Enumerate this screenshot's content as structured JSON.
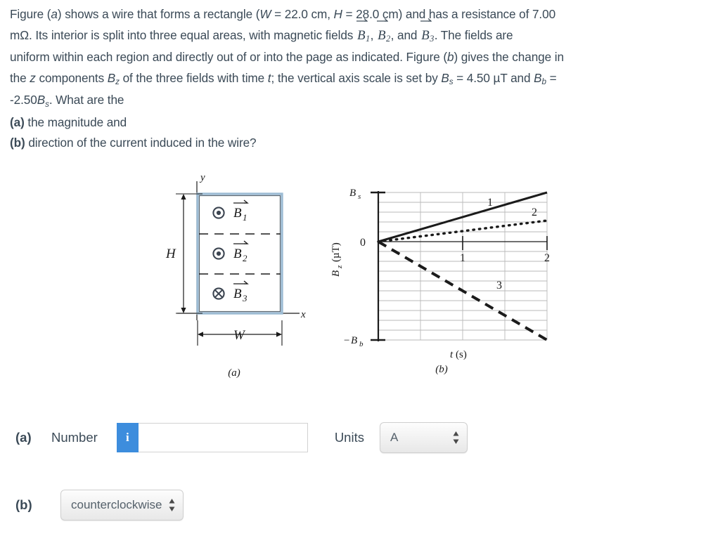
{
  "problem": {
    "line1_a": "Figure (",
    "line1_b": "a",
    "line1_c": ") shows a wire that forms a rectangle (",
    "sym_W": "W",
    "eq_W": " = 22.0 cm, ",
    "sym_H": "H",
    "eq_H": " = 28.0 cm) and has a resistance of 7.00",
    "line2_a": "mΩ. Its interior is split into three equal areas, with magnetic fields ",
    "vec_B": "B",
    "sub1": "1",
    "sub2": "2",
    "sub3": "3",
    "comma": ", ",
    "and": ", and ",
    "line2_end": ". The fields are",
    "line3": "uniform within each region and directly out of or into the page as indicated. Figure (",
    "line3_it": "b",
    "line3_end": ") gives the change in",
    "line4_a": "the ",
    "line4_z": "z",
    "line4_b": " components ",
    "line4_Bz": "B",
    "line4_Bz_sub": "z",
    "line4_c": " of the three fields with time ",
    "line4_t": "t",
    "line4_d": "; the vertical axis scale is set by ",
    "line4_Bs": "B",
    "line4_Bs_sub": "s",
    "line4_e": " = 4.50 µT and ",
    "line4_Bb": "B",
    "line4_Bb_sub": "b",
    "line4_f": " =",
    "line5_a": "-2.50",
    "line5_Bs": "B",
    "line5_Bs_sub": "s",
    "line5_b": ". What are the",
    "line6_label": "(a)",
    "line6_text": " the magnitude and",
    "line7_label": "(b)",
    "line7_text": " direction of the current induced in the wire?"
  },
  "figure_a": {
    "caption": "(a)",
    "axis_x_label": "x",
    "axis_y_label": "y",
    "height_label": "H",
    "width_label": "W",
    "regions": [
      {
        "field_label": "B",
        "subscript": "1",
        "direction": "out-of-page"
      },
      {
        "field_label": "B",
        "subscript": "2",
        "direction": "out-of-page"
      },
      {
        "field_label": "B",
        "subscript": "3",
        "direction": "into-page"
      }
    ],
    "rect_border_color": "#9dbcd4",
    "rect_fill_color": "#ffffff"
  },
  "figure_b": {
    "caption": "(b)",
    "y_axis_label": "B",
    "y_axis_label_sub": "z",
    "y_axis_units": "(µT)",
    "x_axis_label": "t",
    "x_axis_units": "(s)",
    "y_top_label": "B",
    "y_top_label_sub": "s",
    "y_zero_label": "0",
    "y_bottom_label": "−B",
    "y_bottom_label_sub": "b",
    "x_tick_labels": [
      "1",
      "2"
    ],
    "curve_labels": [
      "1",
      "2",
      "3"
    ]
  },
  "chart_data": {
    "type": "line",
    "title": "",
    "xlabel": "t (s)",
    "ylabel": "Bz (µT)",
    "xlim": [
      0,
      2
    ],
    "ylim": [
      -11.25,
      4.5
    ],
    "ytick_labels": {
      "top": "Bs = 4.50",
      "zero": "0",
      "bottom": "-Bb = -11.25"
    },
    "xtick_values": [
      1,
      2
    ],
    "grid": true,
    "legend": "inline-curve-labels",
    "series": [
      {
        "name": "1",
        "style": "solid",
        "x": [
          0,
          2
        ],
        "values": [
          0,
          4.5
        ]
      },
      {
        "name": "2",
        "style": "dotted",
        "x": [
          0,
          2
        ],
        "values": [
          0,
          1.93
        ]
      },
      {
        "name": "3",
        "style": "dashed",
        "x": [
          0,
          2
        ],
        "values": [
          0,
          -11.25
        ]
      }
    ]
  },
  "answers": {
    "part_a_label": "(a)",
    "number_label": "Number",
    "number_value": "",
    "number_placeholder": "",
    "info_icon_text": "i",
    "units_label": "Units",
    "units_value": "A",
    "part_b_label": "(b)",
    "direction_value": "counterclockwise"
  },
  "colors": {
    "text": "#3b4a57",
    "info_button": "#3d8ddd",
    "rect_border": "#9dbcd4",
    "grid": "#b9b9b9"
  }
}
